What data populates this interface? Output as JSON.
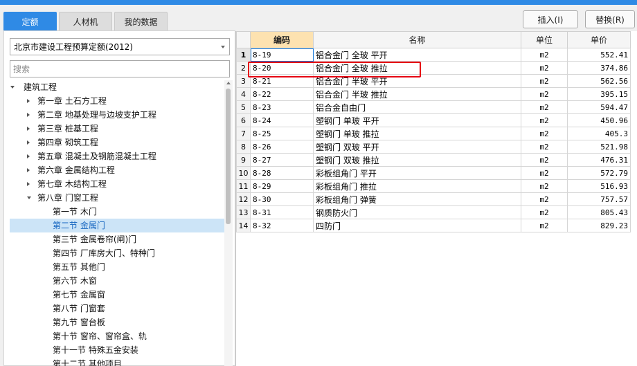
{
  "tabs": [
    {
      "label": "定额",
      "active": true
    },
    {
      "label": "人材机",
      "active": false
    },
    {
      "label": "我的数据",
      "active": false
    }
  ],
  "toolbar": {
    "insert_label": "插入(I)",
    "replace_label": "替换(R)"
  },
  "library": {
    "selected": "北京市建设工程预算定额(2012)"
  },
  "search": {
    "placeholder": "搜索"
  },
  "tree": [
    {
      "label": "建筑工程",
      "level": 0,
      "expanded": true
    },
    {
      "label": "第一章 土石方工程",
      "level": 1,
      "expanded": false
    },
    {
      "label": "第二章 地基处理与边坡支护工程",
      "level": 1,
      "expanded": false
    },
    {
      "label": "第三章 桩基工程",
      "level": 1,
      "expanded": false
    },
    {
      "label": "第四章 砌筑工程",
      "level": 1,
      "expanded": false
    },
    {
      "label": "第五章 混凝土及钢筋混凝土工程",
      "level": 1,
      "expanded": false
    },
    {
      "label": "第六章 金属结构工程",
      "level": 1,
      "expanded": false
    },
    {
      "label": "第七章 木结构工程",
      "level": 1,
      "expanded": false
    },
    {
      "label": "第八章 门窗工程",
      "level": 1,
      "expanded": true
    },
    {
      "label": "第一节 木门",
      "level": 2
    },
    {
      "label": "第二节 金属门",
      "level": 2,
      "selected": true
    },
    {
      "label": "第三节 金属卷帘(闸)门",
      "level": 2
    },
    {
      "label": "第四节 厂库房大门、特种门",
      "level": 2
    },
    {
      "label": "第五节 其他门",
      "level": 2
    },
    {
      "label": "第六节 木窗",
      "level": 2
    },
    {
      "label": "第七节 金属窗",
      "level": 2
    },
    {
      "label": "第八节 门窗套",
      "level": 2
    },
    {
      "label": "第九节 窗台板",
      "level": 2
    },
    {
      "label": "第十节 窗帘、窗帘盒、轨",
      "level": 2
    },
    {
      "label": "第十一节 特殊五金安装",
      "level": 2
    },
    {
      "label": "第十二节 其他项目",
      "level": 2
    }
  ],
  "table": {
    "headers": [
      "",
      "编码",
      "名称",
      "单位",
      "单价"
    ],
    "rows": [
      {
        "idx": "1",
        "code": "8-19",
        "name": "铝合金门 全玻 平开",
        "unit": "m2",
        "price": "552.41"
      },
      {
        "idx": "2",
        "code": "8-20",
        "name": "铝合金门 全玻 推拉",
        "unit": "m2",
        "price": "374.86"
      },
      {
        "idx": "3",
        "code": "8-21",
        "name": "铝合金门 半玻 平开",
        "unit": "m2",
        "price": "562.56"
      },
      {
        "idx": "4",
        "code": "8-22",
        "name": "铝合金门 半玻 推拉",
        "unit": "m2",
        "price": "395.15"
      },
      {
        "idx": "5",
        "code": "8-23",
        "name": "铝合金自由门",
        "unit": "m2",
        "price": "594.47"
      },
      {
        "idx": "6",
        "code": "8-24",
        "name": "塑钢门 单玻 平开",
        "unit": "m2",
        "price": "450.96"
      },
      {
        "idx": "7",
        "code": "8-25",
        "name": "塑钢门 单玻 推拉",
        "unit": "m2",
        "price": "405.3"
      },
      {
        "idx": "8",
        "code": "8-26",
        "name": "塑钢门 双玻 平开",
        "unit": "m2",
        "price": "521.98"
      },
      {
        "idx": "9",
        "code": "8-27",
        "name": "塑钢门 双玻 推拉",
        "unit": "m2",
        "price": "476.31"
      },
      {
        "idx": "10",
        "code": "8-28",
        "name": "彩板组角门 平开",
        "unit": "m2",
        "price": "572.79"
      },
      {
        "idx": "11",
        "code": "8-29",
        "name": "彩板组角门 推拉",
        "unit": "m2",
        "price": "516.93"
      },
      {
        "idx": "12",
        "code": "8-30",
        "name": "彩板组角门 弹簧",
        "unit": "m2",
        "price": "757.57"
      },
      {
        "idx": "13",
        "code": "8-31",
        "name": "钢质防火门",
        "unit": "m2",
        "price": "805.43"
      },
      {
        "idx": "14",
        "code": "8-32",
        "name": "四防门",
        "unit": "m2",
        "price": "829.23"
      }
    ]
  },
  "colors": {
    "accent": "#2f8ae5",
    "highlight": "#e60012",
    "selected_row": "#cce4f7",
    "code_header": "#fde2b0"
  }
}
